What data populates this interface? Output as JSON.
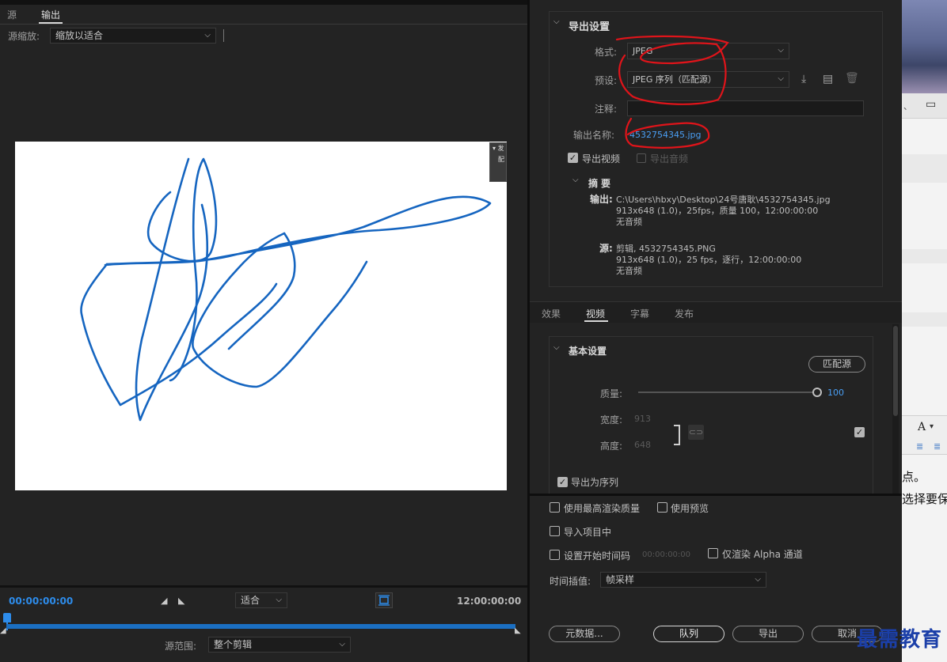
{
  "left": {
    "tabs": [
      "源",
      "输出"
    ],
    "source_zoom_label": "源缩放:",
    "source_zoom_value": "缩放以适合",
    "timecode_start": "00:00:00:00",
    "timecode_end": "12:00:00:00",
    "fit_value": "适合",
    "source_range_label": "源范围:",
    "source_range_value": "整个剪辑",
    "side_tab_text": [
      "▾ 发",
      "配"
    ]
  },
  "export_settings": {
    "header": "导出设置",
    "format_label": "格式:",
    "format_value": "JPEG",
    "preset_label": "预设:",
    "preset_value": "JPEG 序列（匹配源）",
    "comments_label": "注释:",
    "output_name_label": "输出名称:",
    "output_name_value": "4532754345.jpg",
    "export_video_label": "导出视频",
    "export_video_checked": true,
    "export_audio_label": "导出音频",
    "export_audio_checked": false
  },
  "summary": {
    "header": "摘要",
    "output_label": "输出:",
    "output_lines": [
      "C:\\Users\\hbxy\\Desktop\\24号唐耿\\4532754345.jpg",
      "913x648 (1.0)，25fps，质量 100，12:00:00:00",
      "无音频"
    ],
    "source_label": "源:",
    "source_lines": [
      "剪辑, 4532754345.PNG",
      "913x648 (1.0)，25 fps，逐行，12:00:00:00",
      "无音频"
    ]
  },
  "tabs2": [
    "效果",
    "视频",
    "字幕",
    "发布"
  ],
  "basic_settings": {
    "header": "基本设置",
    "match_source_button": "匹配源",
    "quality_label": "质量:",
    "quality_value": "100",
    "quality_fraction": 1.0,
    "width_label": "宽度:",
    "width_value": "913",
    "height_label": "高度:",
    "height_value": "648",
    "export_as_sequence_label": "导出为序列"
  },
  "options": {
    "max_render_quality": "使用最高渲染质量",
    "use_previews": "使用预览",
    "import_into_project": "导入项目中",
    "set_start_timecode": "设置开始时间码",
    "start_timecode_value": "00:00:00:00",
    "render_alpha_only": "仅渲染 Alpha 通道",
    "time_interpolation_label": "时间插值:",
    "time_interpolation_value": "帧采样"
  },
  "buttons": {
    "metadata": "元数据...",
    "queue": "队列",
    "export": "导出",
    "cancel": "取消"
  },
  "strip": {
    "text1": "点。",
    "text2": "选择要保",
    "font_icon": "A",
    "watermark": "最需教育"
  },
  "colors": {
    "accent": "#2d8ceb",
    "stroke": "#1565c0",
    "annotation": "#e0141a"
  }
}
